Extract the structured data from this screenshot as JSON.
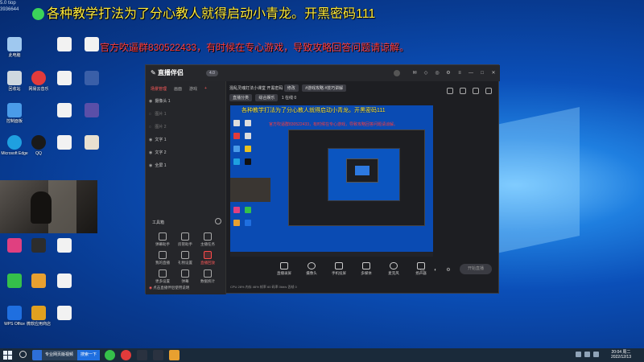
{
  "overlay": {
    "title_line": "各种教学打法为了分心教人就得启动小青龙。开黑密码111",
    "promo_line": "官方吹逼群830522433，有时候在专心游戏，导致攻略回答问题请谅解。",
    "corner_logo": "5.0 tiop 3936644"
  },
  "desktop_icons": [
    {
      "label": "此电脑",
      "color": "#9fc8ef",
      "icon": "computer-icon"
    },
    {
      "label": "回收站",
      "color": "#cfd8e0",
      "icon": "recycle-bin-icon"
    },
    {
      "label": "网易云音乐",
      "color": "#e23b3b",
      "icon": "music-icon"
    },
    {
      "label": "控制面板",
      "color": "#4a9be8",
      "icon": "control-panel-icon"
    },
    {
      "label": "QQ",
      "color": "#1a1a1a",
      "icon": "qq-icon"
    },
    {
      "label": "Microsoft Edge",
      "color": "#1fa0e0",
      "icon": "edge-icon"
    },
    {
      "label": "WPS Office",
      "color": "#1f6fe0",
      "icon": "wps-icon"
    },
    {
      "label": "微软应用商店",
      "color": "#e0a020",
      "icon": "store-icon"
    }
  ],
  "app": {
    "name": "直播伴侣",
    "version": "4.0",
    "tabs": [
      "场景管理",
      "画面",
      "游戏"
    ],
    "scenes": [
      "摄像头 1",
      "图片 1",
      "图片 2",
      "文字 1",
      "文字 2",
      "全屏 1"
    ],
    "tools_label": "工具箱",
    "tools": [
      {
        "label": "弹幕助手"
      },
      {
        "label": "房管助手"
      },
      {
        "label": "主播任务"
      },
      {
        "label": "我的直播"
      },
      {
        "label": "礼物设置"
      },
      {
        "label": "直播回放"
      },
      {
        "label": "更多设置"
      },
      {
        "label": "弹幕"
      },
      {
        "label": "数据统计"
      }
    ],
    "sidebar_footer": "点击直播伴侣使用说明",
    "header": {
      "title": "混乱灵魂打法小课堂 开黑密码",
      "btn1": "修改",
      "tag": "#游戏攻略 #技巧讲解",
      "row2_a": "直播分类",
      "row2_b": "综合娱乐",
      "row2_c": "1 在线",
      "row2_d": "0"
    },
    "preview_line1": "各种教学打法为了分心教人就得启动小青龙。开黑密码111",
    "preview_line2": "官方吹逼群830522433，有时候在专心游戏，导致攻略回答问题请谅解。",
    "controls": [
      "直播录屏",
      "摄像头",
      "手机投屏",
      "多媒体",
      "麦克风",
      "扬声器"
    ],
    "live_button": "开始直播",
    "status": "CPU 28%   内存 46%   帧率 60   码率 0kb/s   丢帧 0"
  },
  "taskbar": {
    "search_placeholder": "专业网页版视频",
    "pill_label": "搜索一下",
    "time": "20:04 周二",
    "date": "2022/12/13"
  }
}
